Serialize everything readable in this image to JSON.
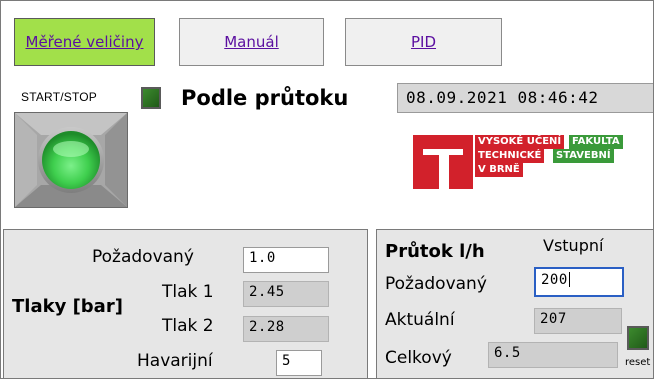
{
  "nav": {
    "measured": "Měřené veličiny",
    "manual": "Manuál",
    "pid": "PID"
  },
  "header": {
    "startstop_label": "START/STOP",
    "mode_title": "Podle průtoku",
    "datetime": "08.09.2021 08:46:42"
  },
  "logo": {
    "line1a": "VYSOKÉ UČENÍ",
    "line1b": "FAKULTA",
    "line2a": "TECHNICKÉ",
    "line2b": "STAVEBNÍ",
    "line3": "V BRNĚ"
  },
  "pressure": {
    "title": "Tlaky [bar]",
    "required_label": "Požadovaný",
    "required_value": "1.0",
    "p1_label": "Tlak 1",
    "p1_value": "2.45",
    "p2_label": "Tlak 2",
    "p2_value": "2.28",
    "emergency_label": "Havarijní",
    "emergency_value": "5"
  },
  "flow": {
    "title": "Průtok l/h",
    "column_label": "Vstupní",
    "required_label": "Požadovaný",
    "required_value": "200",
    "actual_label": "Aktuální",
    "actual_value": "207",
    "total_label": "Celkový",
    "total_value": "6.5",
    "reset_label": "reset"
  },
  "colors": {
    "active_tab": "#a2e04a",
    "panel": "#e6e6e6",
    "led": "#2f7a22",
    "logo_red": "#d2212b",
    "logo_green": "#3a9a3a"
  }
}
